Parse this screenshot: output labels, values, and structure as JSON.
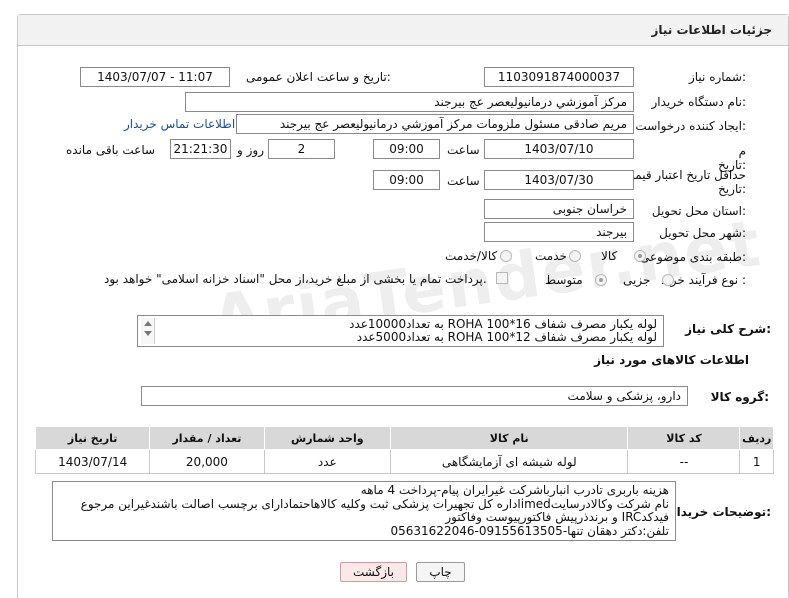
{
  "panel": {
    "title": "جزئیات اطلاعات نیاز"
  },
  "fields": {
    "need_number_label": "شماره نیاز:",
    "need_number": "1103091874000037",
    "announce_label": "تاریخ و ساعت اعلان عمومی:",
    "announce_value": "1403/07/07 - 11:07",
    "buyer_org_label": "نام دستگاه خریدار:",
    "buyer_org": "مرکز آموزشي درمانيوليعصر  عج  بيرجند",
    "creator_label": "ایجاد کننده درخواست:",
    "creator": "مريم صادقی مسئول ملزومات مرکز آموزشي درمانيوليعصر  عج  بيرجند",
    "contact_link": "اطلاعات تماس خریدار",
    "reply_deadline_label": "مهلت ارسال پاسخ: تا تاریخ:",
    "reply_date": "1403/07/10",
    "time_label": "ساعت",
    "reply_time": "09:00",
    "days_value": "2",
    "days_label": "روز و",
    "remaining_value": "21:21:30",
    "remaining_label": "ساعت باقی مانده",
    "min_validity_label": "حداقل تاریخ اعتبار قیمت: تا تاریخ:",
    "validity_date": "1403/07/30",
    "validity_time": "09:00",
    "province_label": "استان محل تحویل:",
    "province": "خراسان جنوبی",
    "city_label": "شهر محل تحویل:",
    "city": "بیرجند",
    "category_label": "طبقه بندی موضوعی:",
    "category_options": [
      "کالا",
      "خدمت",
      "کالا/خدمت"
    ],
    "process_label": "نوع فرآیند خرید :",
    "process_options": [
      "جزیی",
      "متوسط"
    ],
    "payment_note": "پرداخت تمام یا بخشی از مبلغ خرید،از محل \"اسناد خزانه اسلامی\" خواهد بود."
  },
  "summary": {
    "label": "شرح کلی نیاز:",
    "lines": [
      "لوله یکبار مصرف شفاف 16*100 ROHA به تعداد10000عدد",
      "لوله یکبار مصرف شفاف 12*100 ROHA به تعداد5000عدد"
    ]
  },
  "goods": {
    "section_title": "اطلاعات کالاهای مورد نیاز",
    "group_label": "گروه کالا:",
    "group_value": "دارو، پزشکی و سلامت",
    "columns": [
      "ردیف",
      "کد کالا",
      "نام کالا",
      "واحد شمارش",
      "تعداد / مقدار",
      "تاریخ نیاز"
    ],
    "rows": [
      {
        "row": "1",
        "code": "--",
        "name": "لوله شیشه ای آزمایشگاهی",
        "unit": "عدد",
        "qty": "20,000",
        "date": "1403/07/14"
      }
    ]
  },
  "buyer_notes": {
    "label": "توضیحات خریدار:",
    "lines": [
      "هزینه باربری تادرب انبارباشرکت غیرایران پیام-پرداخت 4 ماهه",
      "نام شرکت وکالادرسایتimedاداره کل تجهیرات پزشکی ثبت وکلیه کالاهاحتمادارای برچسب اصالت باشندغیراین مرجوع",
      "فیدکدIRC و برندذرپیش فاکتورپیوست وفاکتور",
      "تلفن:دکتر دهقان تنها-09155613505-05631622046"
    ]
  },
  "buttons": {
    "print": "چاپ",
    "back": "بازگشت"
  },
  "watermark": "AriaTender.net",
  "colors": {
    "link": "#1a4fa3",
    "header_bg": "#f2f2f2",
    "table_header_bg": "#d8d8d8",
    "back_button_bg": "#fbe9ea"
  }
}
